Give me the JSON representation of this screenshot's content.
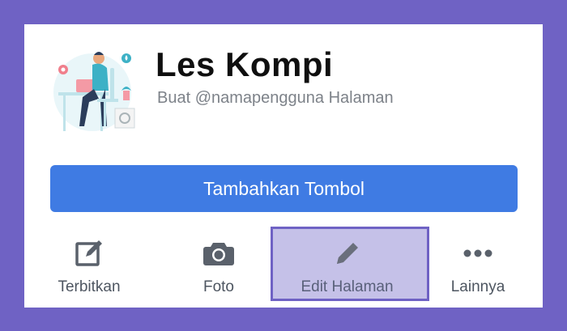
{
  "page": {
    "name": "Les Kompi",
    "subtitle": "Buat @namapengguna Halaman"
  },
  "primary_action": {
    "label": "Tambahkan Tombol"
  },
  "actions": [
    {
      "label": "Terbitkan",
      "icon": "edit-square-icon"
    },
    {
      "label": "Foto",
      "icon": "camera-icon"
    },
    {
      "label": "Edit Halaman",
      "icon": "pencil-icon",
      "highlighted": true
    },
    {
      "label": "Lainnya",
      "icon": "more-dots-icon"
    }
  ],
  "colors": {
    "frame": "#6f62c4",
    "primary_button": "#3f7be3",
    "highlight": "#c5c1e8",
    "icon": "#5a616b"
  }
}
